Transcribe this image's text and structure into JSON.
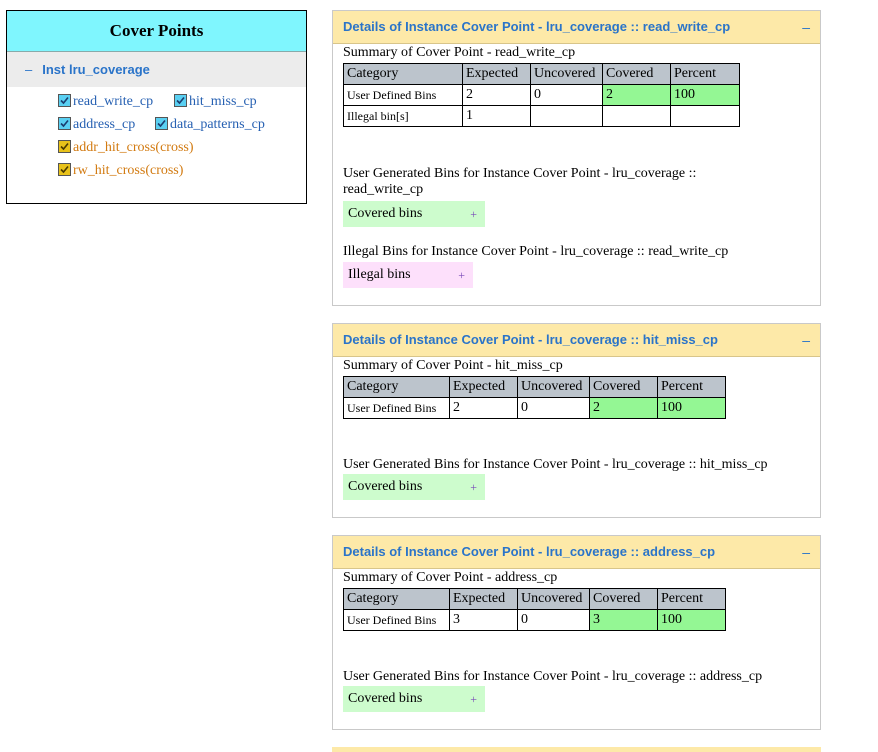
{
  "tree": {
    "title": "Cover Points",
    "instance": {
      "toggle": "–",
      "label": "Inst lru_coverage"
    },
    "items": [
      {
        "label": "read_write_cp",
        "type": "cp"
      },
      {
        "label": "hit_miss_cp",
        "type": "cp"
      },
      {
        "label": "address_cp",
        "type": "cp"
      },
      {
        "label": "data_patterns_cp",
        "type": "cp"
      },
      {
        "label": "addr_hit_cross(cross)",
        "type": "cross"
      },
      {
        "label": "rw_hit_cross(cross)",
        "type": "cross"
      }
    ]
  },
  "columns": [
    "Category",
    "Expected",
    "Uncovered",
    "Covered",
    "Percent"
  ],
  "panels": [
    {
      "title": "Details of Instance Cover Point - lru_coverage :: read_write_cp",
      "minimize": "–",
      "summary": "Summary of Cover Point - read_write_cp",
      "rows": [
        [
          "User Defined Bins",
          "2",
          "0",
          "2",
          "100"
        ],
        [
          "Illegal bin[s]",
          "1",
          "",
          "",
          ""
        ]
      ],
      "user_bins_title": "User Generated Bins for Instance Cover Point - lru_coverage :: read_write_cp",
      "covered_btn": "Covered bins",
      "illegal_title": "Illegal Bins for Instance Cover Point - lru_coverage :: read_write_cp",
      "illegal_btn": "Illegal bins",
      "plus": "+"
    },
    {
      "title": "Details of Instance Cover Point - lru_coverage :: hit_miss_cp",
      "minimize": "–",
      "summary": "Summary of Cover Point - hit_miss_cp",
      "rows": [
        [
          "User Defined Bins",
          "2",
          "0",
          "2",
          "100"
        ]
      ],
      "user_bins_title": "User Generated Bins for Instance Cover Point - lru_coverage :: hit_miss_cp",
      "covered_btn": "Covered bins",
      "plus": "+"
    },
    {
      "title": "Details of Instance Cover Point - lru_coverage :: address_cp",
      "minimize": "–",
      "summary": "Summary of Cover Point - address_cp",
      "rows": [
        [
          "User Defined Bins",
          "3",
          "0",
          "3",
          "100"
        ]
      ],
      "user_bins_title": "User Generated Bins for Instance Cover Point - lru_coverage :: address_cp",
      "covered_btn": "Covered bins",
      "plus": "+"
    }
  ],
  "colors": {
    "covered_green": "#94f794",
    "header_gray": "#bcc4cc",
    "panel_header": "#fde9a8",
    "tree_header": "#7ff6fe"
  }
}
